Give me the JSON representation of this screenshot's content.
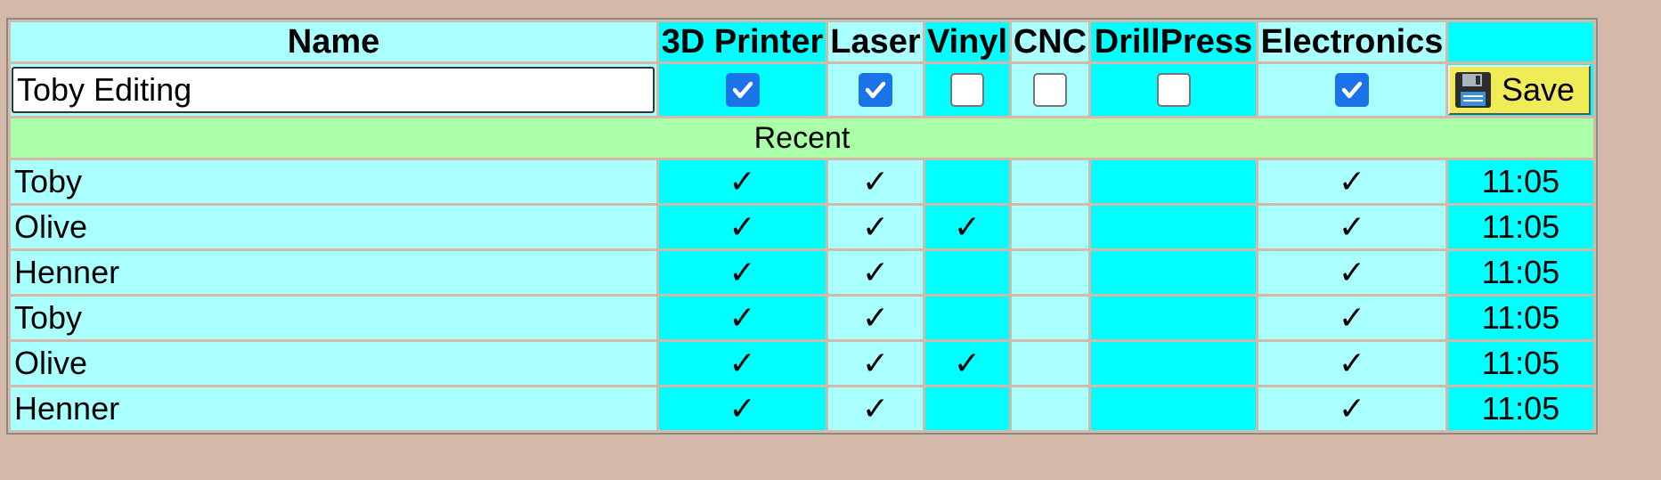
{
  "header": {
    "name": "Name",
    "printer3d": "3D Printer",
    "laser": "Laser",
    "vinyl": "Vinyl",
    "cnc": "CNC",
    "drillpress": "DrillPress",
    "electronics": "Electronics",
    "time": ""
  },
  "edit_row": {
    "name_value": "Toby Editing",
    "printer3d_checked": true,
    "laser_checked": true,
    "vinyl_checked": false,
    "cnc_checked": false,
    "drillpress_checked": false,
    "electronics_checked": true,
    "save_label": "Save",
    "save_icon": "floppy-disk-icon"
  },
  "recent_label": "Recent",
  "check_mark": "✓",
  "rows": [
    {
      "name": "Toby",
      "printer3d": "✓",
      "laser": "✓",
      "vinyl": "",
      "cnc": "",
      "drillpress": "",
      "electronics": "✓",
      "time": "11:05"
    },
    {
      "name": "Olive",
      "printer3d": "✓",
      "laser": "✓",
      "vinyl": "✓",
      "cnc": "",
      "drillpress": "",
      "electronics": "✓",
      "time": "11:05"
    },
    {
      "name": "Henner",
      "printer3d": "✓",
      "laser": "✓",
      "vinyl": "",
      "cnc": "",
      "drillpress": "",
      "electronics": "✓",
      "time": "11:05"
    },
    {
      "name": "Toby",
      "printer3d": "✓",
      "laser": "✓",
      "vinyl": "",
      "cnc": "",
      "drillpress": "",
      "electronics": "✓",
      "time": "11:05"
    },
    {
      "name": "Olive",
      "printer3d": "✓",
      "laser": "✓",
      "vinyl": "✓",
      "cnc": "",
      "drillpress": "",
      "electronics": "✓",
      "time": "11:05"
    },
    {
      "name": "Henner",
      "printer3d": "✓",
      "laser": "✓",
      "vinyl": "",
      "cnc": "",
      "drillpress": "",
      "electronics": "✓",
      "time": "11:05"
    }
  ],
  "colors": {
    "page_background": "#d4b8a8",
    "light_cyan": "#aaffff",
    "cyan": "#00ffff",
    "recent_green": "#aaffa8",
    "save_yellow": "#f0ec58",
    "checkbox_blue": "#1a73e8"
  }
}
